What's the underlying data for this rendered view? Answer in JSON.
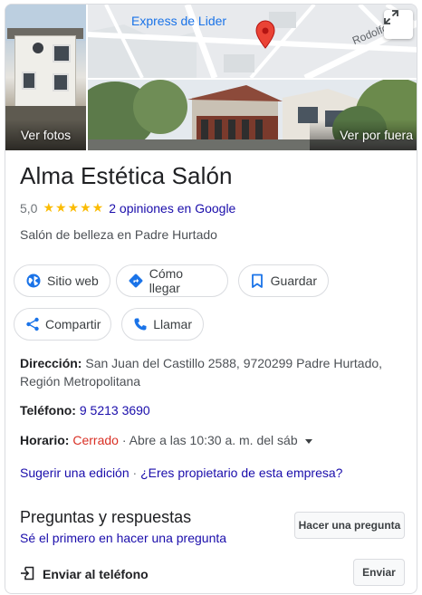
{
  "photos": {
    "fotos_label": "Ver fotos",
    "outside_label": "Ver por fuera",
    "map_place_label": "Express de Lider",
    "map_street_label": "Rodolfo J"
  },
  "business": {
    "name": "Alma Estética Salón",
    "rating": "5,0",
    "stars": "★★★★★",
    "reviews_text": "2 opiniones en Google",
    "category": "Salón de belleza en Padre Hurtado"
  },
  "actions": {
    "website": "Sitio web",
    "directions": "Cómo llegar",
    "save": "Guardar",
    "share": "Compartir",
    "call": "Llamar"
  },
  "details": {
    "address_label": "Dirección:",
    "address_value": "San Juan del Castillo 2588, 9720299 Padre Hurtado, Región Metropolitana",
    "phone_label": "Teléfono:",
    "phone_value": "9 5213 3690",
    "hours_label": "Horario:",
    "hours_status": "Cerrado",
    "hours_detail": "· Abre a las 10:30 a. m. del sáb"
  },
  "links": {
    "suggest_edit": "Sugerir una edición",
    "separator": "·",
    "owner": "¿Eres propietario de esta empresa?"
  },
  "qa": {
    "title": "Preguntas y respuestas",
    "first_link": "Sé el primero en hacer una pregunta",
    "ask_button": "Hacer una pregunta"
  },
  "send": {
    "label": "Enviar al teléfono",
    "button": "Enviar"
  },
  "colors": {
    "link": "#1a0dab",
    "star": "#fbbc04",
    "closed": "#d93025",
    "icon_blue": "#1a73e8",
    "pin": "#ea4335"
  },
  "icons": [
    "expand-icon",
    "map-pin-icon",
    "globe-icon",
    "directions-icon",
    "bookmark-icon",
    "share-icon",
    "phone-icon",
    "send-to-phone-icon",
    "dropdown-caret-icon"
  ]
}
